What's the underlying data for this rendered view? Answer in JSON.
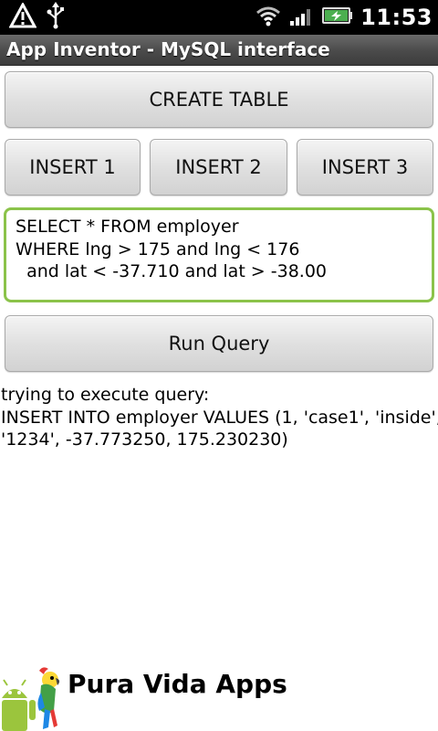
{
  "status_bar": {
    "time": "11:53",
    "icons": [
      "warning-triangle-icon",
      "usb-icon",
      "wifi-icon",
      "signal-bars-icon",
      "battery-charging-icon"
    ]
  },
  "title_bar": {
    "title": "App Inventor - MySQL interface"
  },
  "buttons": {
    "create_table": "CREATE TABLE",
    "insert_1": "INSERT 1",
    "insert_2": "INSERT 2",
    "insert_3": "INSERT 3",
    "run_query": "Run Query"
  },
  "query_input": {
    "value": "SELECT * FROM employer\nWHERE lng > 175 and lng < 176\n  and lat < -37.710 and lat > -38.00"
  },
  "output": {
    "text": "trying to execute query:\nINSERT INTO employer VALUES (1, 'case1', 'inside',\n'1234', -37.773250, 175.230230)"
  },
  "branding": {
    "label": "Pura Vida Apps"
  },
  "colors": {
    "input_focus_border": "#8bc34a",
    "battery_green": "#4caf50",
    "title_bar": "#4a4a4a"
  }
}
